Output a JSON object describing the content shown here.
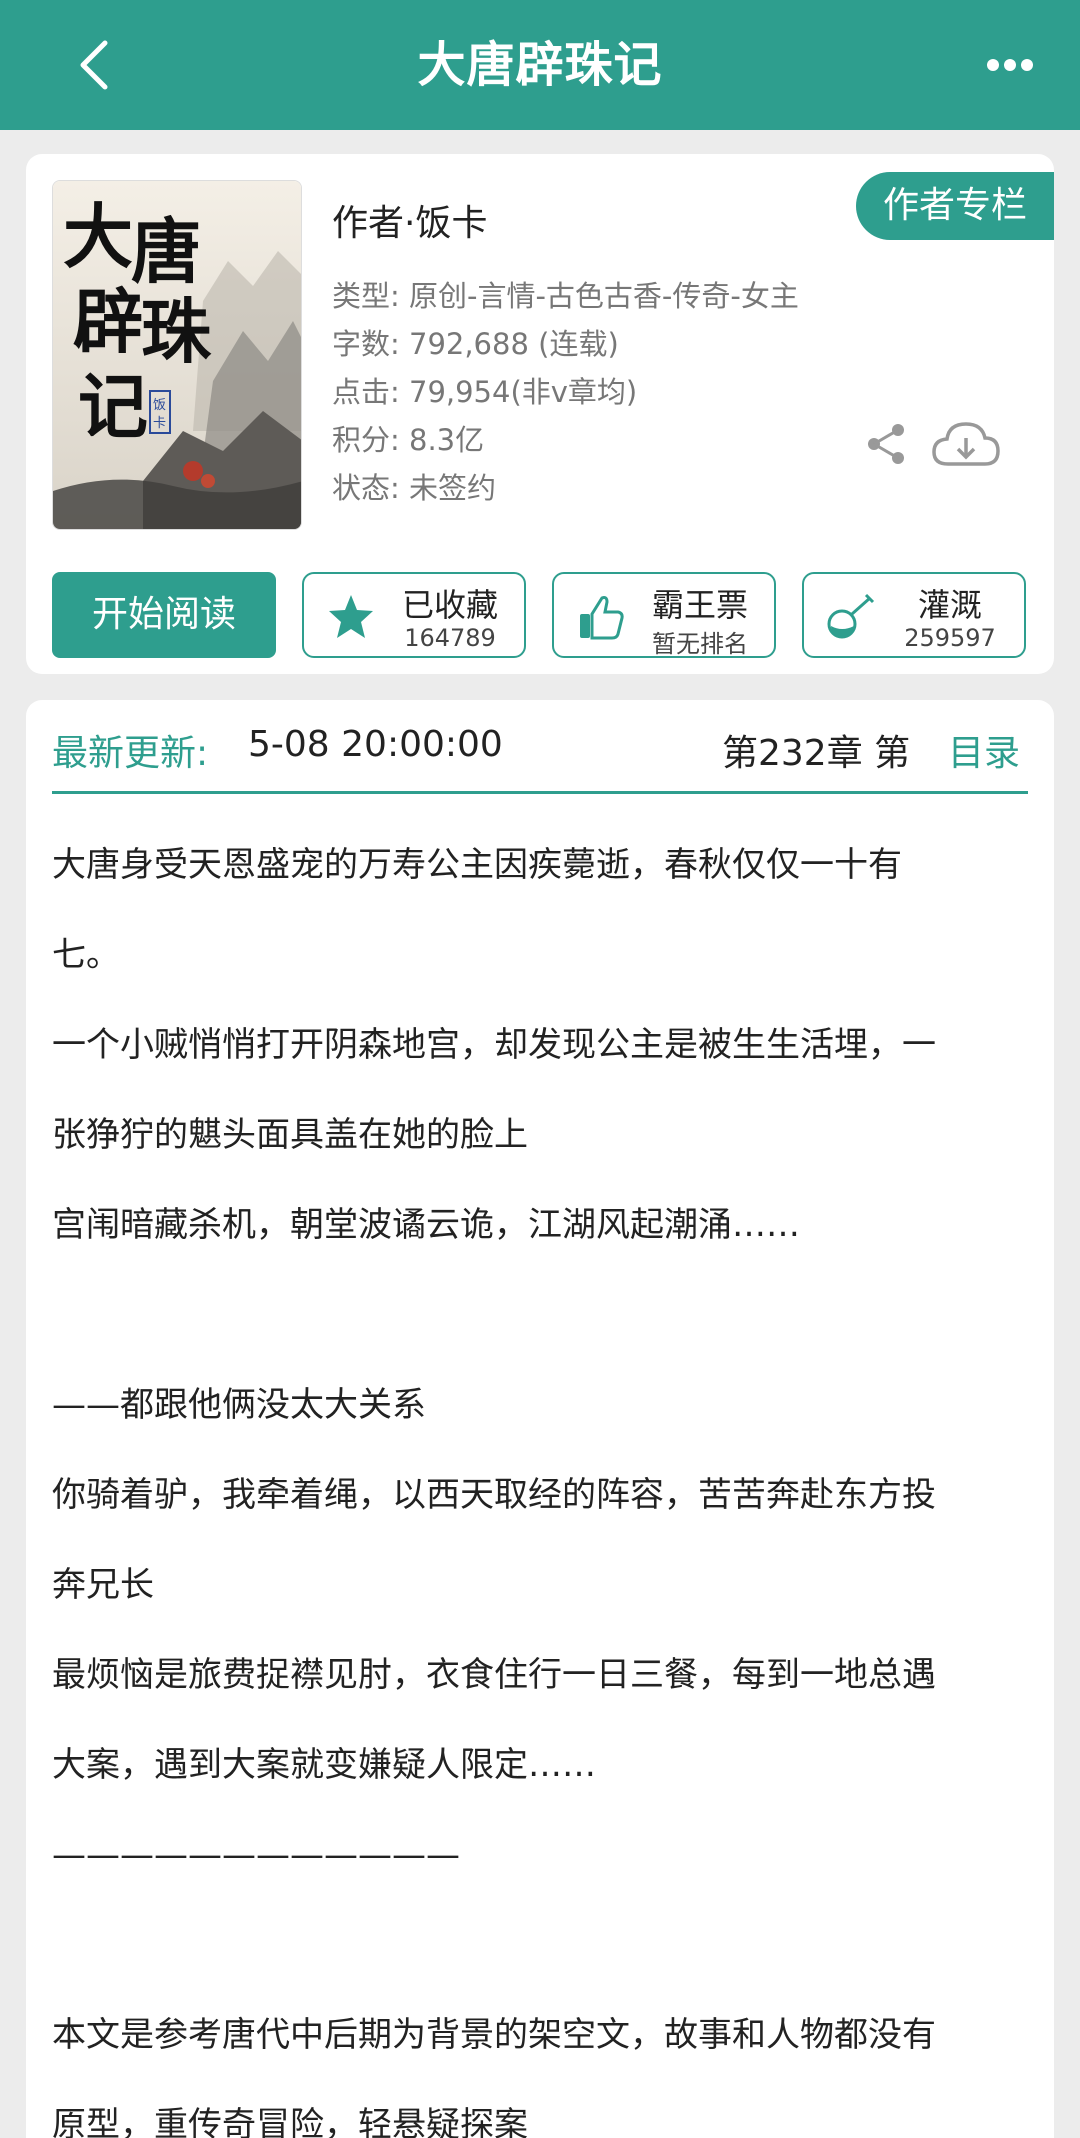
{
  "header": {
    "title": "大唐辟珠记"
  },
  "book": {
    "cover_text": "大唐辟珠记",
    "cover_seal": "饭卡",
    "author": "作者·饭卡",
    "author_column": "作者专栏",
    "meta": [
      "类型: 原创-言情-古色古香-传奇-女主",
      "字数: 792,688 (连载)",
      "点击: 79,954(非v章均)",
      "积分: 8.3亿",
      "状态: 未签约"
    ]
  },
  "actions": {
    "read": "开始阅读",
    "favorite": {
      "label": "已收藏",
      "value": "164789"
    },
    "ticket": {
      "label": "霸王票",
      "value": "暂无排名"
    },
    "water": {
      "label": "灌溉",
      "value": "259597"
    }
  },
  "update": {
    "label": "最新更新:",
    "time": "5-08 20:00:00",
    "chapter": "第232章 第",
    "toc": "目录"
  },
  "intro": [
    "大唐身受天恩盛宠的万寿公主因疾薨逝，春秋仅仅一十有",
    "七。",
    "一个小贼悄悄打开阴森地宫，却发现公主是被生生活埋，一",
    "张狰狞的魌头面具盖在她的脸上",
    "宫闱暗藏杀机，朝堂波谲云诡，江湖风起潮涌……",
    "",
    "——都跟他俩没太大关系",
    "你骑着驴，我牵着绳，以西天取经的阵容，苦苦奔赴东方投",
    "奔兄长",
    "最烦恼是旅费捉襟见肘，衣食住行一日三餐，每到一地总遇",
    "大案，遇到大案就变嫌疑人限定……",
    "————————————",
    "",
    "本文是参考唐代中后期为背景的架空文，故事和人物都没有",
    "原型，重传奇冒险，轻悬疑探案"
  ],
  "colors": {
    "accent": "#2e9e8e",
    "background": "#ececec"
  }
}
